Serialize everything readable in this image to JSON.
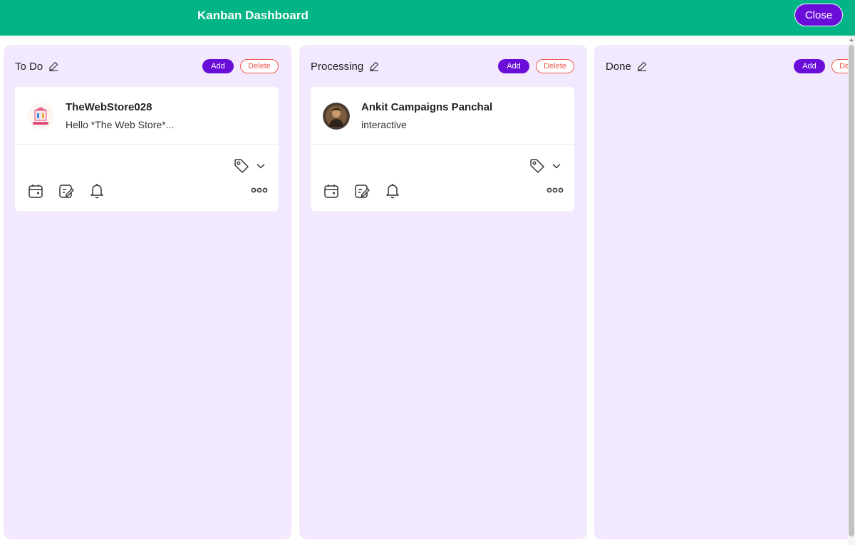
{
  "header": {
    "title": "Kanban Dashboard",
    "close_label": "Close",
    "bg_color": "#03b487",
    "accent_color": "#6a0dd9"
  },
  "columns": [
    {
      "title": "To Do",
      "add_label": "Add",
      "delete_label": "Delete",
      "cards": [
        {
          "name": "TheWebStore028",
          "message": "Hello *The Web Store*...",
          "avatar": "store-logo"
        }
      ]
    },
    {
      "title": "Processing",
      "add_label": "Add",
      "delete_label": "Delete",
      "cards": [
        {
          "name": "Ankit Campaigns Panchal",
          "message": "interactive",
          "avatar": "person-photo"
        }
      ]
    },
    {
      "title": "Done",
      "add_label": "Add",
      "delete_label": "Delete",
      "cards": []
    }
  ],
  "card_icons": [
    "tag-icon",
    "chevron-down-icon",
    "calendar-icon",
    "note-edit-icon",
    "bell-icon",
    "more-icon"
  ],
  "colors": {
    "column_bg": "#f3e9fe",
    "delete": "#ef5a50"
  }
}
